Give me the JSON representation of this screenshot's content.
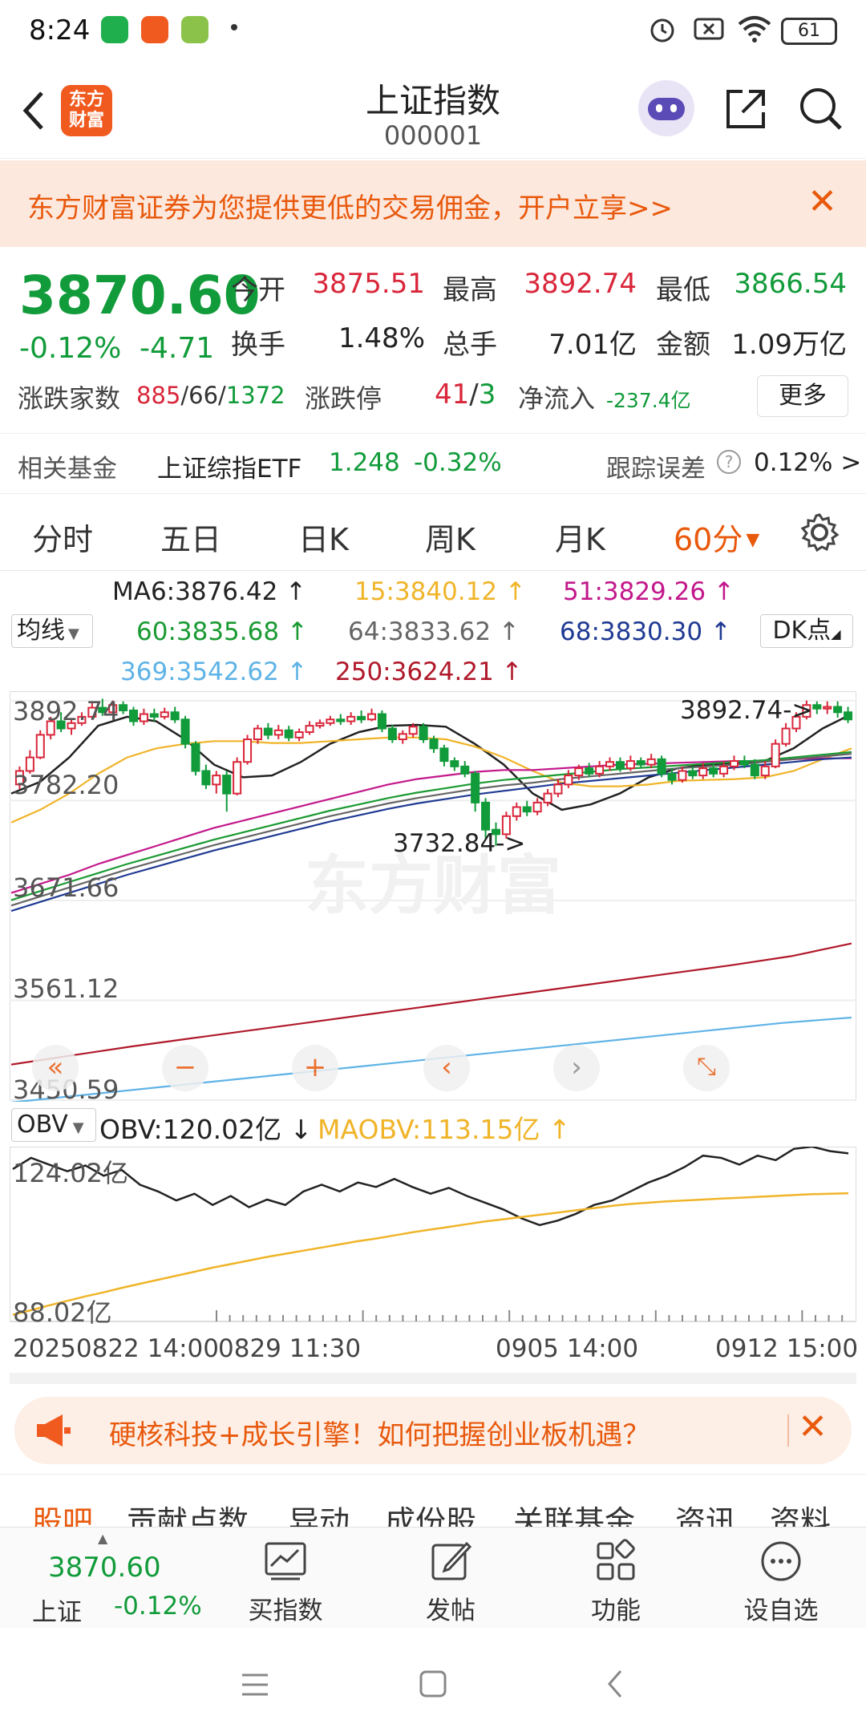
{
  "status_bar": {
    "time": "8:24",
    "battery": "61"
  },
  "header": {
    "title": "上证指数",
    "code": "000001",
    "logo_text": "东方财富"
  },
  "banner": {
    "text": "东方财富证券为您提供更低的交易佣金，开户立享>>"
  },
  "quote": {
    "price": "3870.60",
    "change_pct": "-0.12%",
    "change": "-4.71",
    "open_label": "今开",
    "open": "3875.51",
    "high_label": "最高",
    "high": "3892.74",
    "low_label": "最低",
    "low": "3866.54",
    "turnover_label": "换手",
    "turnover": "1.48%",
    "volume_label": "总手",
    "volume": "7.01亿",
    "amount_label": "金额",
    "amount": "1.09万亿",
    "breadth_label": "涨跌家数",
    "breadth_up": "885",
    "breadth_flat": "66",
    "breadth_down": "1372",
    "limit_label": "涨跌停",
    "limit_up": "41",
    "limit_down": "3",
    "netflow_label": "净流入",
    "netflow": "-237.4亿",
    "more": "更多"
  },
  "fund": {
    "label": "相关基金",
    "name": "上证综指ETF",
    "price": "1.248",
    "change": "-0.32%",
    "tracking_label": "跟踪误差",
    "tracking_value": "0.12% >"
  },
  "tabs": [
    "分时",
    "五日",
    "日K",
    "周K",
    "月K",
    "60分"
  ],
  "active_tab": "60分",
  "ma": {
    "selector": "均线",
    "dk": "DK点",
    "items": [
      {
        "text": "MA6:3876.42",
        "color": "#222222"
      },
      {
        "text": "15:3840.12",
        "color": "#f0b429"
      },
      {
        "text": "51:3829.26",
        "color": "#c2188b"
      },
      {
        "text": "60:3835.68",
        "color": "#1a9a32"
      },
      {
        "text": "64:3833.62",
        "color": "#666666"
      },
      {
        "text": "68:3830.30",
        "color": "#1f3a93"
      },
      {
        "text": "369:3542.62",
        "color": "#5fb3e6"
      },
      {
        "text": "250:3624.21",
        "color": "#b0192a"
      }
    ]
  },
  "chart_data": [
    {
      "type": "candlestick",
      "title": "",
      "y_ticks": [
        "3892.74",
        "3782.20",
        "3671.66",
        "3561.12",
        "3450.59"
      ],
      "ylim": [
        3450.59,
        3903.3
      ],
      "annotations": [
        "3892.74->",
        "3732.84->"
      ],
      "watermark": "东方财富",
      "candles": [
        {
          "o": 3800,
          "c": 3815,
          "h": 3820,
          "l": 3795
        },
        {
          "o": 3815,
          "c": 3830,
          "h": 3838,
          "l": 3812
        },
        {
          "o": 3830,
          "c": 3855,
          "h": 3860,
          "l": 3828
        },
        {
          "o": 3855,
          "c": 3870,
          "h": 3875,
          "l": 3850
        },
        {
          "o": 3870,
          "c": 3862,
          "h": 3880,
          "l": 3858
        },
        {
          "o": 3862,
          "c": 3868,
          "h": 3872,
          "l": 3855
        },
        {
          "o": 3868,
          "c": 3875,
          "h": 3880,
          "l": 3865
        },
        {
          "o": 3875,
          "c": 3885,
          "h": 3892,
          "l": 3872
        },
        {
          "o": 3885,
          "c": 3880,
          "h": 3895,
          "l": 3876
        },
        {
          "o": 3880,
          "c": 3888,
          "h": 3893,
          "l": 3878
        },
        {
          "o": 3888,
          "c": 3882,
          "h": 3892,
          "l": 3878
        },
        {
          "o": 3882,
          "c": 3870,
          "h": 3886,
          "l": 3865
        },
        {
          "o": 3870,
          "c": 3878,
          "h": 3884,
          "l": 3866
        },
        {
          "o": 3878,
          "c": 3875,
          "h": 3884,
          "l": 3870
        },
        {
          "o": 3875,
          "c": 3880,
          "h": 3885,
          "l": 3872
        },
        {
          "o": 3880,
          "c": 3872,
          "h": 3886,
          "l": 3868
        },
        {
          "o": 3872,
          "c": 3845,
          "h": 3876,
          "l": 3840
        },
        {
          "o": 3845,
          "c": 3815,
          "h": 3848,
          "l": 3810
        },
        {
          "o": 3815,
          "c": 3800,
          "h": 3822,
          "l": 3795
        },
        {
          "o": 3800,
          "c": 3810,
          "h": 3815,
          "l": 3790
        },
        {
          "o": 3810,
          "c": 3790,
          "h": 3815,
          "l": 3770
        },
        {
          "o": 3790,
          "c": 3825,
          "h": 3830,
          "l": 3788
        },
        {
          "o": 3825,
          "c": 3850,
          "h": 3855,
          "l": 3822
        },
        {
          "o": 3850,
          "c": 3862,
          "h": 3866,
          "l": 3845
        },
        {
          "o": 3862,
          "c": 3855,
          "h": 3868,
          "l": 3850
        },
        {
          "o": 3855,
          "c": 3860,
          "h": 3866,
          "l": 3850
        },
        {
          "o": 3860,
          "c": 3852,
          "h": 3865,
          "l": 3848
        },
        {
          "o": 3852,
          "c": 3858,
          "h": 3862,
          "l": 3848
        },
        {
          "o": 3858,
          "c": 3865,
          "h": 3870,
          "l": 3855
        },
        {
          "o": 3865,
          "c": 3868,
          "h": 3872,
          "l": 3862
        },
        {
          "o": 3868,
          "c": 3872,
          "h": 3876,
          "l": 3865
        },
        {
          "o": 3872,
          "c": 3870,
          "h": 3878,
          "l": 3866
        },
        {
          "o": 3870,
          "c": 3875,
          "h": 3880,
          "l": 3866
        },
        {
          "o": 3875,
          "c": 3872,
          "h": 3882,
          "l": 3868
        },
        {
          "o": 3872,
          "c": 3878,
          "h": 3884,
          "l": 3870
        },
        {
          "o": 3878,
          "c": 3862,
          "h": 3882,
          "l": 3858
        },
        {
          "o": 3862,
          "c": 3850,
          "h": 3866,
          "l": 3846
        },
        {
          "o": 3850,
          "c": 3856,
          "h": 3860,
          "l": 3845
        },
        {
          "o": 3856,
          "c": 3864,
          "h": 3868,
          "l": 3852
        },
        {
          "o": 3864,
          "c": 3850,
          "h": 3868,
          "l": 3846
        },
        {
          "o": 3850,
          "c": 3840,
          "h": 3854,
          "l": 3835
        },
        {
          "o": 3840,
          "c": 3826,
          "h": 3844,
          "l": 3820
        },
        {
          "o": 3826,
          "c": 3820,
          "h": 3830,
          "l": 3815
        },
        {
          "o": 3820,
          "c": 3812,
          "h": 3826,
          "l": 3808
        },
        {
          "o": 3812,
          "c": 3780,
          "h": 3815,
          "l": 3770
        },
        {
          "o": 3780,
          "c": 3750,
          "h": 3785,
          "l": 3740
        },
        {
          "o": 3750,
          "c": 3745,
          "h": 3758,
          "l": 3732
        },
        {
          "o": 3745,
          "c": 3765,
          "h": 3770,
          "l": 3740
        },
        {
          "o": 3765,
          "c": 3775,
          "h": 3780,
          "l": 3760
        },
        {
          "o": 3775,
          "c": 3770,
          "h": 3782,
          "l": 3765
        },
        {
          "o": 3770,
          "c": 3780,
          "h": 3785,
          "l": 3766
        },
        {
          "o": 3780,
          "c": 3790,
          "h": 3795,
          "l": 3776
        },
        {
          "o": 3790,
          "c": 3800,
          "h": 3806,
          "l": 3786
        },
        {
          "o": 3800,
          "c": 3810,
          "h": 3816,
          "l": 3796
        },
        {
          "o": 3810,
          "c": 3818,
          "h": 3822,
          "l": 3805
        },
        {
          "o": 3818,
          "c": 3812,
          "h": 3824,
          "l": 3808
        },
        {
          "o": 3812,
          "c": 3820,
          "h": 3826,
          "l": 3808
        },
        {
          "o": 3820,
          "c": 3825,
          "h": 3830,
          "l": 3815
        },
        {
          "o": 3825,
          "c": 3818,
          "h": 3830,
          "l": 3814
        },
        {
          "o": 3818,
          "c": 3826,
          "h": 3832,
          "l": 3815
        },
        {
          "o": 3826,
          "c": 3822,
          "h": 3830,
          "l": 3818
        },
        {
          "o": 3822,
          "c": 3828,
          "h": 3834,
          "l": 3818
        },
        {
          "o": 3828,
          "c": 3812,
          "h": 3832,
          "l": 3808
        },
        {
          "o": 3812,
          "c": 3805,
          "h": 3818,
          "l": 3800
        },
        {
          "o": 3805,
          "c": 3815,
          "h": 3820,
          "l": 3802
        },
        {
          "o": 3815,
          "c": 3810,
          "h": 3820,
          "l": 3806
        },
        {
          "o": 3810,
          "c": 3818,
          "h": 3824,
          "l": 3806
        },
        {
          "o": 3818,
          "c": 3812,
          "h": 3824,
          "l": 3808
        },
        {
          "o": 3812,
          "c": 3820,
          "h": 3826,
          "l": 3808
        },
        {
          "o": 3820,
          "c": 3826,
          "h": 3832,
          "l": 3816
        },
        {
          "o": 3826,
          "c": 3822,
          "h": 3832,
          "l": 3818
        },
        {
          "o": 3822,
          "c": 3810,
          "h": 3828,
          "l": 3806
        },
        {
          "o": 3810,
          "c": 3820,
          "h": 3826,
          "l": 3806
        },
        {
          "o": 3820,
          "c": 3845,
          "h": 3850,
          "l": 3818
        },
        {
          "o": 3845,
          "c": 3862,
          "h": 3868,
          "l": 3842
        },
        {
          "o": 3862,
          "c": 3875,
          "h": 3880,
          "l": 3858
        },
        {
          "o": 3875,
          "c": 3888,
          "h": 3893,
          "l": 3872
        },
        {
          "o": 3888,
          "c": 3884,
          "h": 3892,
          "l": 3878
        },
        {
          "o": 3884,
          "c": 3886,
          "h": 3892,
          "l": 3878
        },
        {
          "o": 3886,
          "c": 3880,
          "h": 3892,
          "l": 3874
        },
        {
          "o": 3880,
          "c": 3872,
          "h": 3886,
          "l": 3868
        }
      ],
      "ma_lines": [
        {
          "name": "MA6",
          "color": "#222222",
          "values": [
            3790,
            3803,
            3830,
            3865,
            3875,
            3870,
            3850,
            3822,
            3808,
            3810,
            3825,
            3845,
            3858,
            3865,
            3866,
            3864,
            3845,
            3822,
            3790,
            3772,
            3778,
            3790,
            3808,
            3818,
            3822,
            3824,
            3826,
            3840,
            3862,
            3878
          ]
        },
        {
          "name": "15",
          "color": "#f0b429",
          "values": [
            3758,
            3772,
            3790,
            3812,
            3830,
            3840,
            3845,
            3848,
            3848,
            3846,
            3846,
            3848,
            3850,
            3852,
            3852,
            3850,
            3842,
            3830,
            3815,
            3802,
            3798,
            3798,
            3800,
            3804,
            3805,
            3806,
            3808,
            3815,
            3828,
            3840
          ]
        },
        {
          "name": "51",
          "color": "#c2188b",
          "values": [
            3680,
            3690,
            3700,
            3712,
            3722,
            3732,
            3742,
            3752,
            3760,
            3768,
            3776,
            3784,
            3792,
            3800,
            3806,
            3810,
            3814,
            3816,
            3816,
            3818,
            3820,
            3822,
            3823,
            3824,
            3825,
            3826,
            3826,
            3828,
            3829,
            3829
          ]
        },
        {
          "name": "60",
          "color": "#1a9a32",
          "values": [
            3672,
            3682,
            3692,
            3702,
            3712,
            3721,
            3730,
            3739,
            3747,
            3755,
            3763,
            3771,
            3778,
            3785,
            3791,
            3796,
            3801,
            3805,
            3808,
            3811,
            3814,
            3817,
            3819,
            3821,
            3823,
            3825,
            3827,
            3830,
            3833,
            3836
          ]
        },
        {
          "name": "64",
          "color": "#666666",
          "values": [
            3666,
            3676,
            3686,
            3696,
            3706,
            3715,
            3724,
            3733,
            3741,
            3749,
            3757,
            3765,
            3772,
            3779,
            3785,
            3790,
            3795,
            3799,
            3802,
            3806,
            3809,
            3812,
            3815,
            3818,
            3820,
            3822,
            3825,
            3828,
            3831,
            3834
          ]
        },
        {
          "name": "68",
          "color": "#1f3a93",
          "values": [
            3660,
            3670,
            3680,
            3690,
            3700,
            3709,
            3718,
            3727,
            3735,
            3743,
            3751,
            3759,
            3766,
            3773,
            3779,
            3784,
            3789,
            3793,
            3797,
            3801,
            3804,
            3807,
            3810,
            3813,
            3816,
            3819,
            3822,
            3825,
            3828,
            3830
          ]
        },
        {
          "name": "250",
          "color": "#b0192a",
          "values": [
            3490,
            3500,
            3510,
            3519,
            3528,
            3537,
            3546,
            3555,
            3564,
            3573,
            3582,
            3591,
            3600,
            3610,
            3624
          ]
        },
        {
          "name": "369",
          "color": "#5fb3e6",
          "values": [
            3448,
            3456,
            3464,
            3472,
            3480,
            3488,
            3496,
            3504,
            3512,
            3520,
            3528,
            3536,
            3542
          ]
        }
      ]
    },
    {
      "type": "line",
      "title": "",
      "indicator": "OBV",
      "y_ticks": [
        "124.02亿",
        "88.02亿"
      ],
      "ylim": [
        87.0,
        126.0
      ],
      "series": [
        {
          "name": "OBV",
          "color": "#222222",
          "values": [
            121,
            123.5,
            122,
            120.5,
            121.8,
            119.5,
            120.8,
            117.5,
            116,
            114,
            115.5,
            113,
            115,
            112.5,
            114.2,
            113,
            116,
            117.5,
            116,
            118,
            117,
            118.8,
            117,
            115.5,
            116.8,
            115,
            113.5,
            112,
            110,
            108.5,
            109.5,
            111,
            113,
            114,
            116,
            118,
            119.5,
            121.5,
            124,
            123.5,
            122,
            124,
            123,
            125.5,
            126,
            125,
            124.5
          ]
        },
        {
          "name": "MAOBV",
          "color": "#f0b429",
          "values": [
            88.5,
            89.5,
            90.6,
            91.6,
            92.6,
            93.5,
            94.5,
            95.4,
            96.3,
            97.2,
            98.1,
            99.0,
            99.8,
            100.6,
            101.4,
            102.1,
            102.8,
            103.5,
            104.2,
            104.9,
            105.5,
            106.2,
            106.9,
            107.5,
            108.1,
            108.7,
            109.3,
            109.8,
            110.3,
            110.8,
            111.3,
            111.8,
            112.3,
            112.8,
            113.2,
            113.5,
            113.8,
            114.0,
            114.2,
            114.4,
            114.6,
            114.8,
            115.0,
            115.2,
            115.4,
            115.5,
            115.6
          ]
        }
      ],
      "x_ticks": [
        "20250822 14:00",
        "0829 11:30",
        "0905 14:00",
        "0912 15:00"
      ]
    }
  ],
  "obv_legend": {
    "selector": "OBV",
    "obv": "OBV:120.02亿",
    "maobv": "MAOBV:113.15亿"
  },
  "ad": {
    "text": "硬核科技+成长引擎！如何把握创业板机遇？"
  },
  "content_tabs": [
    "股吧",
    "贡献点数",
    "异动",
    "成份股",
    "关联基金",
    "资讯",
    "资料"
  ],
  "bottom_bar": {
    "index_price": "3870.60",
    "index_name": "上证",
    "index_change": "-0.12%",
    "items": [
      "买指数",
      "发帖",
      "功能",
      "设自选"
    ]
  }
}
